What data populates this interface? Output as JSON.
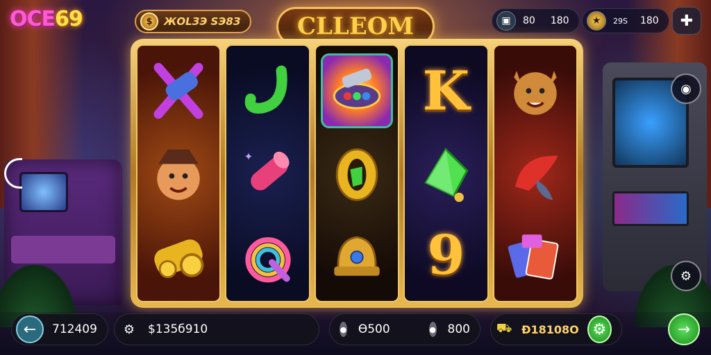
{
  "logo": {
    "part_a": "OCE",
    "part_b": "69"
  },
  "top": {
    "balance_text": "ЖOLЗЭ SЭ8З",
    "title": "CLLEOM",
    "stat1_value": "80",
    "stat1_extra": "180",
    "stat2_label": "29S",
    "stat2_value": "180"
  },
  "reels": [
    [
      "scroll-symbol",
      "green-note-symbol",
      "wild-chest-symbol"
    ],
    [
      "pirate-face-symbol",
      "pink-tube-symbol",
      "rainbow-symbol"
    ],
    [
      "gem-tray-symbol",
      "gold-zero-symbol",
      "golden-helmet-symbol"
    ],
    [
      "K",
      "green-gem-symbol",
      "9"
    ],
    [
      "lion-face-symbol",
      "red-feather-symbol",
      "cards-symbol"
    ]
  ],
  "bottom": {
    "credit": "712409",
    "total_win": "$135б910",
    "bet": "Ѳ500",
    "lines": "800",
    "jackpot": "Ð18108О"
  },
  "colors": {
    "frame_gold": "#f0c868",
    "accent_green": "#4ad04a",
    "accent_teal": "#2b6a7e"
  }
}
